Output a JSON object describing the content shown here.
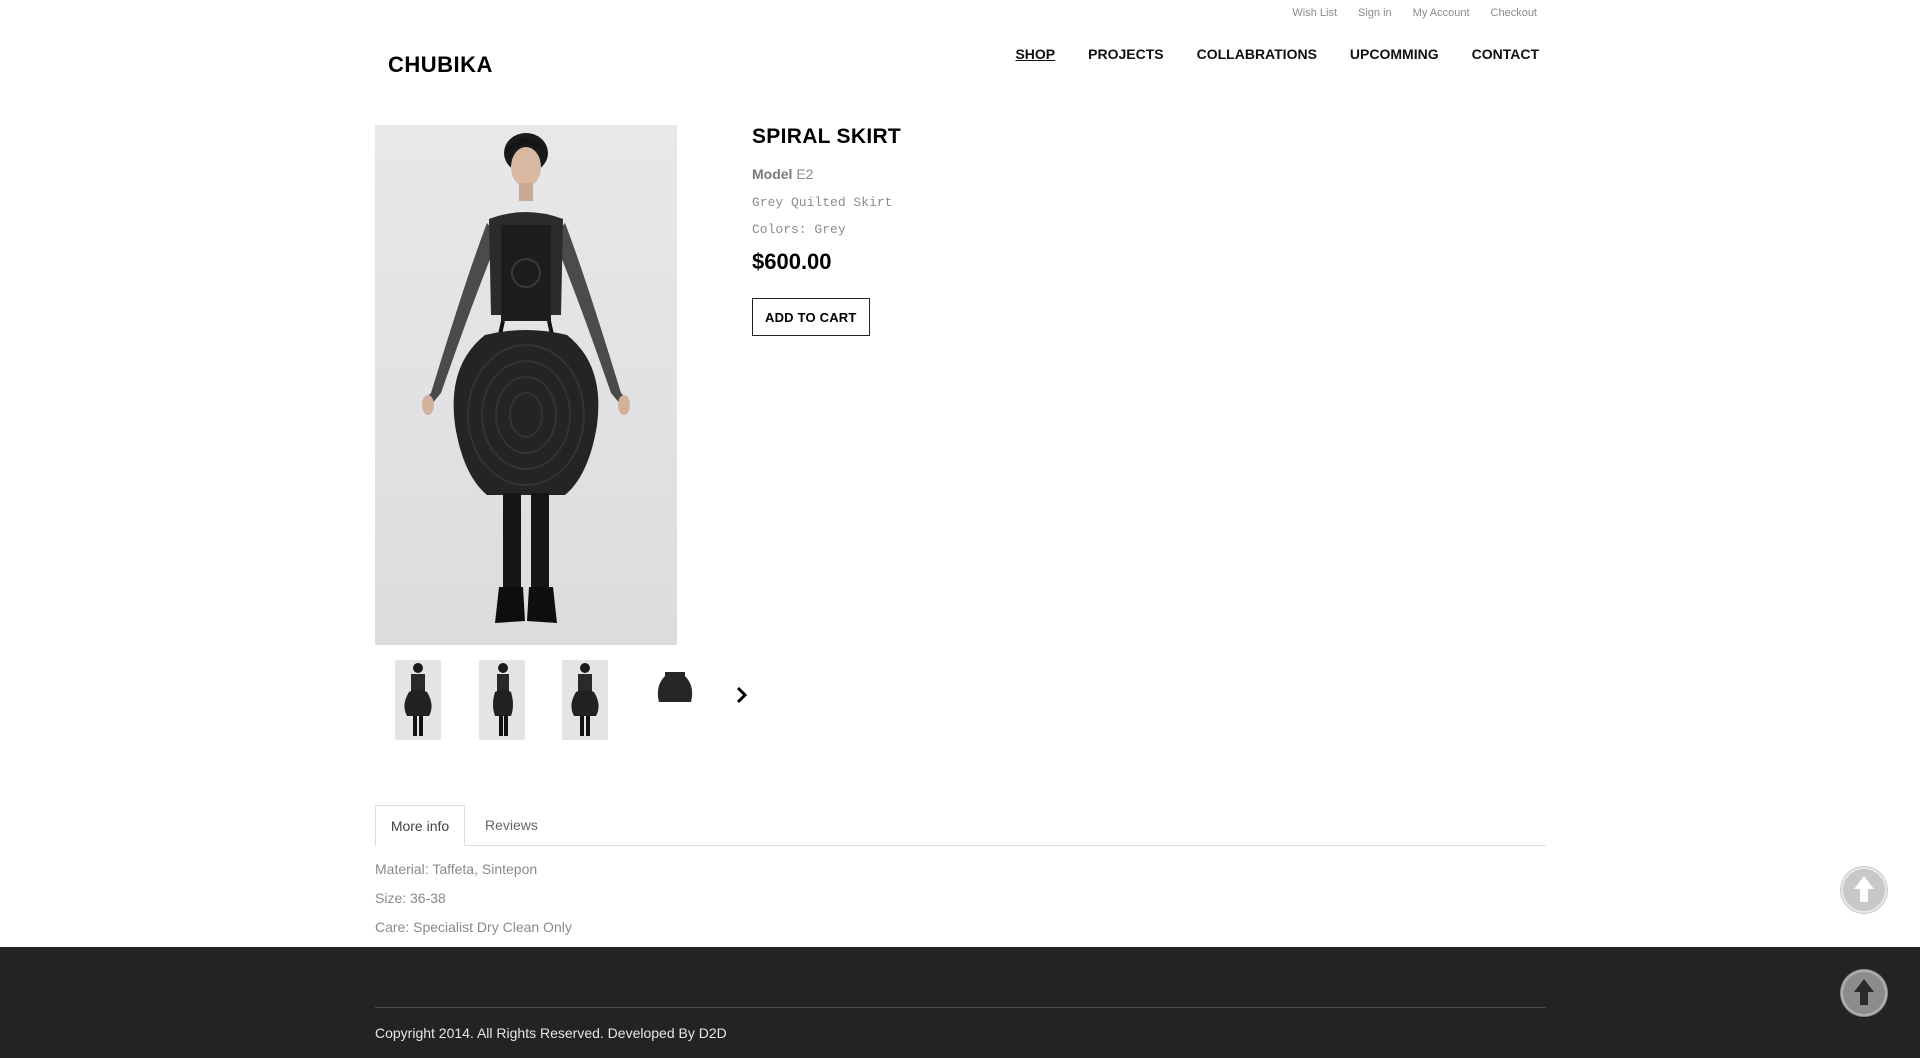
{
  "utility_links": [
    "Wish List",
    "Sign in",
    "My Account",
    "Checkout"
  ],
  "logo": "CHUBIKA",
  "nav": [
    {
      "label": "SHOP",
      "active": true
    },
    {
      "label": "PROJECTS",
      "active": false
    },
    {
      "label": "COLLABRATIONS",
      "active": false
    },
    {
      "label": "UPCOMMING",
      "active": false
    },
    {
      "label": "CONTACT",
      "active": false
    }
  ],
  "product": {
    "title": "SPIRAL SKIRT",
    "model_label": "Model",
    "model_value": "E2",
    "description": "Grey Quilted Skirt",
    "colors": "Colors: Grey",
    "price": "$600.00",
    "add_to_cart": "ADD TO CART"
  },
  "thumbnails": {
    "items": [
      "front-view",
      "side-view",
      "back-view",
      "skirt-detail"
    ],
    "next_icon": "chevron-right-icon"
  },
  "tabs": {
    "more_info": "More info",
    "reviews": "Reviews"
  },
  "more_info": {
    "material": "Material: Taffeta, Sintepon",
    "size": "Size: 36-38",
    "care": "Care:  Specialist Dry Clean Only"
  },
  "footer": {
    "copyright": "Copyright 2014. All Rights Reserved. Developed By D2D"
  },
  "scroll_top_icon": "arrow-up-icon",
  "colors": {
    "footer_bg": "#232323",
    "muted_text": "#8a8a8a",
    "image_bg": "#e3e3e5"
  }
}
